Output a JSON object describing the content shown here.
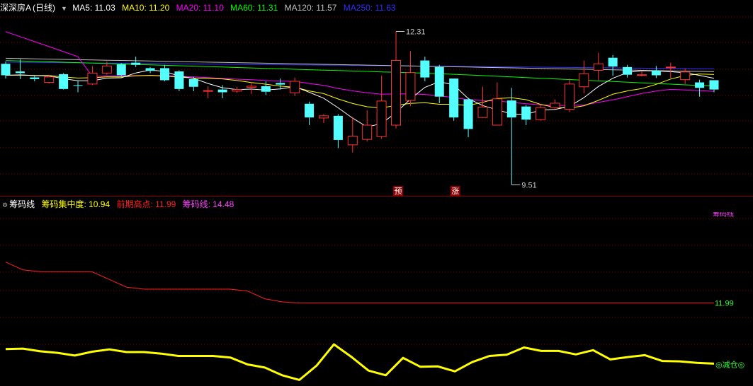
{
  "header": {
    "stock_name": "深深房A",
    "period": "(日线)",
    "ma": [
      {
        "label": "MA5: 11.03",
        "color": "#ffffff"
      },
      {
        "label": "MA10: 11.20",
        "color": "#ffff00"
      },
      {
        "label": "MA20: 11.10",
        "color": "#ff00ff"
      },
      {
        "label": "MA60: 11.31",
        "color": "#00ff00"
      },
      {
        "label": "MA120: 11.57",
        "color": "#c0c0c0"
      },
      {
        "label": "MA250: 11.63",
        "color": "#3030ff"
      }
    ]
  },
  "indicator_header": {
    "name": "筹码线",
    "items": [
      {
        "label": "筹码集中度: 10.94",
        "color": "#ffff00"
      },
      {
        "label": "前期高点: 11.99",
        "color": "#ff2020"
      },
      {
        "label": "筹码线: 14.48",
        "color": "#ff40ff"
      }
    ]
  },
  "annotations": {
    "high_label": "12.31",
    "low_label": "9.51",
    "tag1": "预",
    "tag2": "涨",
    "resistance_label": "11.99",
    "signal_label": "◎减仓◎",
    "chip_line_label": "筹码线"
  },
  "colors": {
    "up": "#ff3232",
    "down": "#54ffff",
    "grid": "#8b0000",
    "chip": "#ffff00",
    "prior_high": "#ff2020",
    "signal": "#30ff30"
  },
  "chart_data": [
    {
      "type": "candlestick",
      "title": "深深房A (日线)",
      "ylim": [
        9.4,
        12.6
      ],
      "x": [
        1,
        2,
        3,
        4,
        5,
        6,
        7,
        8,
        9,
        10,
        11,
        12,
        13,
        14,
        15,
        16,
        17,
        18,
        19,
        20,
        21,
        22,
        23,
        24,
        25,
        26,
        27,
        28,
        29,
        30,
        31,
        32,
        33,
        34,
        35,
        36,
        37,
        38,
        39,
        40,
        41,
        42,
        43,
        44,
        45,
        46,
        47,
        48,
        49,
        50
      ],
      "open": [
        11.72,
        11.58,
        11.47,
        11.38,
        11.53,
        11.33,
        11.35,
        11.55,
        11.71,
        11.74,
        11.64,
        11.64,
        11.58,
        11.44,
        11.22,
        11.25,
        11.22,
        11.29,
        11.31,
        11.37,
        11.19,
        10.99,
        10.73,
        10.77,
        10.24,
        10.34,
        10.39,
        10.6,
        11.05,
        11.78,
        11.66,
        11.45,
        11.07,
        10.74,
        10.6,
        11.05,
        10.94,
        10.7,
        10.92,
        10.89,
        11.3,
        11.6,
        11.83,
        11.66,
        11.52,
        11.6,
        11.66,
        11.43,
        11.38,
        11.42
      ],
      "close": [
        11.51,
        11.55,
        11.44,
        11.48,
        11.26,
        11.32,
        11.55,
        11.68,
        11.51,
        11.7,
        11.59,
        11.42,
        11.26,
        11.3,
        11.23,
        11.2,
        11.25,
        11.31,
        11.21,
        11.34,
        11.4,
        10.74,
        10.77,
        10.33,
        10.4,
        10.6,
        11.04,
        11.78,
        11.56,
        11.47,
        11.12,
        10.74,
        10.53,
        10.93,
        11.08,
        10.74,
        10.7,
        10.92,
        11.0,
        11.35,
        11.54,
        11.72,
        11.67,
        11.52,
        11.52,
        11.51,
        11.66,
        11.57,
        11.28,
        11.25
      ],
      "high": [
        11.76,
        11.8,
        11.5,
        11.52,
        11.55,
        11.42,
        11.68,
        11.76,
        11.73,
        11.85,
        11.66,
        11.7,
        11.6,
        11.48,
        11.31,
        11.33,
        11.3,
        11.38,
        11.4,
        11.45,
        11.47,
        11.03,
        10.8,
        10.8,
        10.75,
        10.87,
        11.5,
        12.31,
        11.95,
        11.85,
        11.7,
        11.45,
        11.1,
        11.3,
        11.38,
        11.28,
        10.97,
        10.98,
        11.07,
        11.45,
        11.78,
        11.92,
        11.88,
        11.7,
        11.58,
        11.68,
        11.74,
        11.63,
        11.43,
        11.42
      ],
      "low": [
        11.45,
        11.44,
        11.4,
        11.36,
        11.25,
        11.2,
        11.33,
        11.52,
        11.49,
        11.66,
        11.55,
        11.4,
        11.22,
        11.22,
        11.09,
        11.09,
        11.19,
        11.17,
        11.15,
        11.25,
        11.13,
        10.6,
        10.64,
        10.18,
        10.1,
        10.3,
        10.35,
        10.54,
        10.95,
        11.4,
        11.0,
        10.68,
        10.38,
        10.73,
        10.68,
        9.51,
        10.6,
        10.68,
        10.9,
        10.84,
        11.18,
        11.42,
        11.5,
        11.47,
        11.49,
        11.46,
        11.46,
        11.35,
        11.12,
        11.2
      ]
    },
    {
      "type": "line",
      "title": "筹码线",
      "series": [
        {
          "name": "筹码集中度",
          "values": [
            10.8,
            10.81,
            10.74,
            10.7,
            10.63,
            10.73,
            10.79,
            10.72,
            10.72,
            10.68,
            10.62,
            10.62,
            10.62,
            10.58,
            10.4,
            10.32,
            10.12,
            10.0,
            10.37,
            10.92,
            10.6,
            10.24,
            10.12,
            10.57,
            10.34,
            10.35,
            10.22,
            10.46,
            10.62,
            10.65,
            10.84,
            10.75,
            10.75,
            10.66,
            10.77,
            10.53,
            10.59,
            10.64,
            10.49,
            10.48,
            10.44,
            10.42
          ]
        },
        {
          "name": "前期高点",
          "values": [
            13.05,
            12.85,
            12.8,
            12.8,
            12.8,
            12.8,
            12.6,
            12.4,
            12.35,
            12.35,
            12.35,
            12.35,
            12.35,
            12.35,
            12.3,
            12.1,
            12.02,
            11.99,
            11.99,
            11.99,
            11.99,
            11.99,
            11.99,
            11.99,
            11.99,
            11.99,
            11.99,
            11.99,
            11.99,
            11.99,
            11.99,
            11.99,
            11.99,
            11.99,
            11.99,
            11.99,
            11.99,
            11.99,
            11.99,
            11.99,
            11.99,
            11.99
          ]
        }
      ]
    }
  ]
}
